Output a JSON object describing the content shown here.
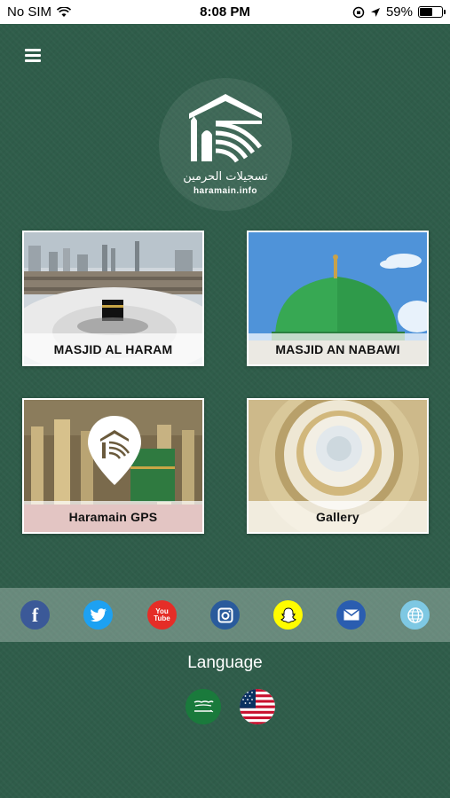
{
  "status_bar": {
    "carrier": "No SIM",
    "time": "8:08 PM",
    "battery_percent": "59%",
    "battery_level": 0.59
  },
  "header": {
    "logo_arabic": "تسجيلات الحرمين",
    "logo_caption": "haramain.info"
  },
  "tiles": [
    {
      "label": "MASJID AL HARAM"
    },
    {
      "label": "MASJID AN NABAWI"
    },
    {
      "label": "Haramain GPS"
    },
    {
      "label": "Gallery"
    }
  ],
  "social": [
    {
      "icon": "facebook-icon",
      "glyph": "f",
      "color": "#3b5998"
    },
    {
      "icon": "twitter-icon",
      "glyph": "",
      "color": "#1da1f2"
    },
    {
      "icon": "youtube-icon",
      "glyph": "You Tube",
      "color": "#e52d27"
    },
    {
      "icon": "instagram-icon",
      "glyph": "",
      "color": "#2a5b9c"
    },
    {
      "icon": "snapchat-icon",
      "glyph": "",
      "color": "#fffc00"
    },
    {
      "icon": "mail-icon",
      "glyph": "",
      "color": "#2a5db0"
    },
    {
      "icon": "globe-icon",
      "glyph": "",
      "color": "#7ec8e3"
    }
  ],
  "language": {
    "title": "Language",
    "options": [
      {
        "icon": "saudi-flag-icon"
      },
      {
        "icon": "us-flag-icon"
      }
    ]
  },
  "colors": {
    "background": "#2f5d4a",
    "tile_border": "#ffffff"
  }
}
